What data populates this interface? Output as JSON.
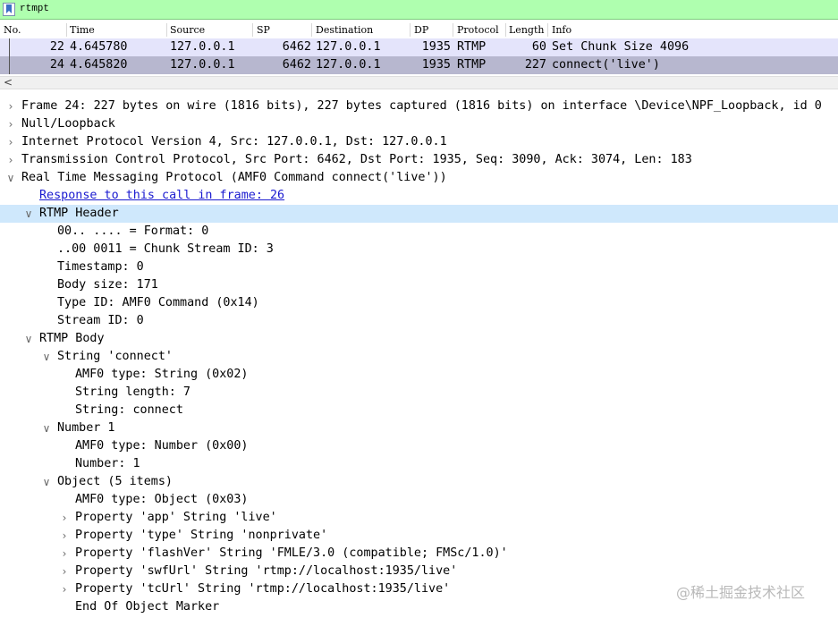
{
  "filter": {
    "value": "rtmpt"
  },
  "packet_list": {
    "columns": [
      "No.",
      "Time",
      "Source",
      "SP",
      "Destination",
      "DP",
      "Protocol",
      "Length",
      "Info"
    ],
    "rows": [
      {
        "no": "22",
        "time": "4.645780",
        "source": "127.0.0.1",
        "sp": "6462",
        "destination": "127.0.0.1",
        "dp": "1935",
        "protocol": "RTMP",
        "length": "60",
        "info": "Set Chunk Size 4096"
      },
      {
        "no": "24",
        "time": "4.645820",
        "source": "127.0.0.1",
        "sp": "6462",
        "destination": "127.0.0.1",
        "dp": "1935",
        "protocol": "RTMP",
        "length": "227",
        "info": "connect('live')"
      }
    ]
  },
  "scroll_arrow": "<",
  "tree": [
    {
      "text": "Frame 24: 227 bytes on wire (1816 bits), 227 bytes captured (1816 bits) on interface \\Device\\NPF_Loopback, id 0",
      "level": 0,
      "expander": "collapsed"
    },
    {
      "text": "Null/Loopback",
      "level": 0,
      "expander": "collapsed"
    },
    {
      "text": "Internet Protocol Version 4, Src: 127.0.0.1, Dst: 127.0.0.1",
      "level": 0,
      "expander": "collapsed"
    },
    {
      "text": "Transmission Control Protocol, Src Port: 6462, Dst Port: 1935, Seq: 3090, Ack: 3074, Len: 183",
      "level": 0,
      "expander": "collapsed"
    },
    {
      "text": "Real Time Messaging Protocol (AMF0 Command connect('live'))",
      "level": 0,
      "expander": "expanded"
    },
    {
      "text": "Response to this call in frame: 26",
      "level": 1,
      "expander": "none",
      "link": true
    },
    {
      "text": "RTMP Header",
      "level": 1,
      "expander": "expanded",
      "selected": true
    },
    {
      "text": "00.. .... = Format: 0",
      "level": 2,
      "expander": "none"
    },
    {
      "text": "..00 0011 = Chunk Stream ID: 3",
      "level": 2,
      "expander": "none"
    },
    {
      "text": "Timestamp: 0",
      "level": 2,
      "expander": "none"
    },
    {
      "text": "Body size: 171",
      "level": 2,
      "expander": "none"
    },
    {
      "text": "Type ID: AMF0 Command (0x14)",
      "level": 2,
      "expander": "none"
    },
    {
      "text": "Stream ID: 0",
      "level": 2,
      "expander": "none"
    },
    {
      "text": "RTMP Body",
      "level": 1,
      "expander": "expanded"
    },
    {
      "text": "String 'connect'",
      "level": 2,
      "expander": "expanded"
    },
    {
      "text": "AMF0 type: String (0x02)",
      "level": 3,
      "expander": "none"
    },
    {
      "text": "String length: 7",
      "level": 3,
      "expander": "none"
    },
    {
      "text": "String: connect",
      "level": 3,
      "expander": "none"
    },
    {
      "text": "Number 1",
      "level": 2,
      "expander": "expanded"
    },
    {
      "text": "AMF0 type: Number (0x00)",
      "level": 3,
      "expander": "none"
    },
    {
      "text": "Number: 1",
      "level": 3,
      "expander": "none"
    },
    {
      "text": "Object (5 items)",
      "level": 2,
      "expander": "expanded"
    },
    {
      "text": "AMF0 type: Object (0x03)",
      "level": 3,
      "expander": "none"
    },
    {
      "text": "Property 'app' String 'live'",
      "level": 3,
      "expander": "collapsed"
    },
    {
      "text": "Property 'type' String 'nonprivate'",
      "level": 3,
      "expander": "collapsed"
    },
    {
      "text": "Property 'flashVer' String 'FMLE/3.0 (compatible; FMSc/1.0)'",
      "level": 3,
      "expander": "collapsed"
    },
    {
      "text": "Property 'swfUrl' String 'rtmp://localhost:1935/live'",
      "level": 3,
      "expander": "collapsed"
    },
    {
      "text": "Property 'tcUrl' String 'rtmp://localhost:1935/live'",
      "level": 3,
      "expander": "collapsed"
    },
    {
      "text": "End Of Object Marker",
      "level": 3,
      "expander": "none"
    }
  ],
  "watermark": "@稀土掘金技术社区"
}
